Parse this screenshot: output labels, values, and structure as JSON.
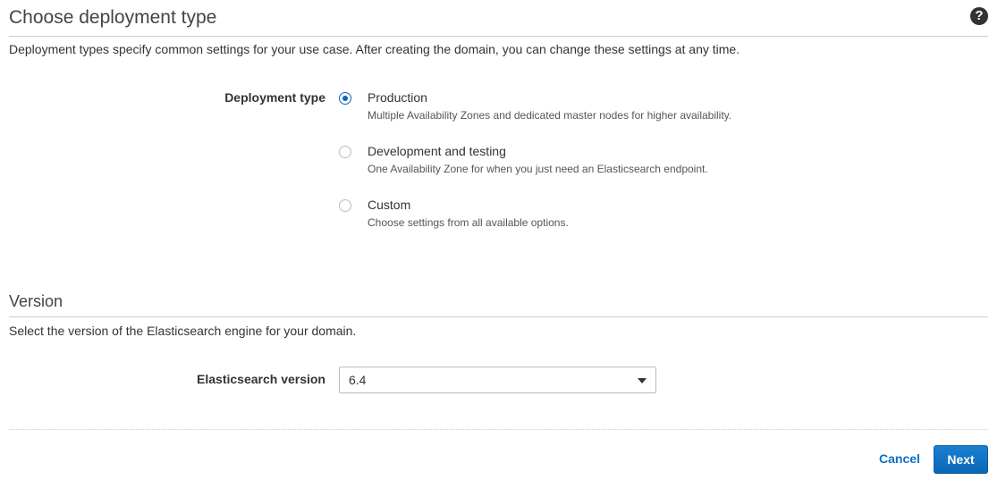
{
  "deployment": {
    "title": "Choose deployment type",
    "help_icon": "question-circle-icon",
    "description": "Deployment types specify common settings for your use case. After creating the domain, you can change these settings at any time.",
    "field_label": "Deployment type",
    "options": [
      {
        "label": "Production",
        "description": "Multiple Availability Zones and dedicated master nodes for higher availability.",
        "selected": true
      },
      {
        "label": "Development and testing",
        "description": "One Availability Zone for when you just need an Elasticsearch endpoint.",
        "selected": false
      },
      {
        "label": "Custom",
        "description": "Choose settings from all available options.",
        "selected": false
      }
    ]
  },
  "version": {
    "title": "Version",
    "description": "Select the version of the Elasticsearch engine for your domain.",
    "field_label": "Elasticsearch version",
    "selected_value": "6.4"
  },
  "footer": {
    "cancel_label": "Cancel",
    "next_label": "Next"
  },
  "colors": {
    "accent": "#0a66b8",
    "link": "#0a6fc2",
    "text": "#333333"
  }
}
